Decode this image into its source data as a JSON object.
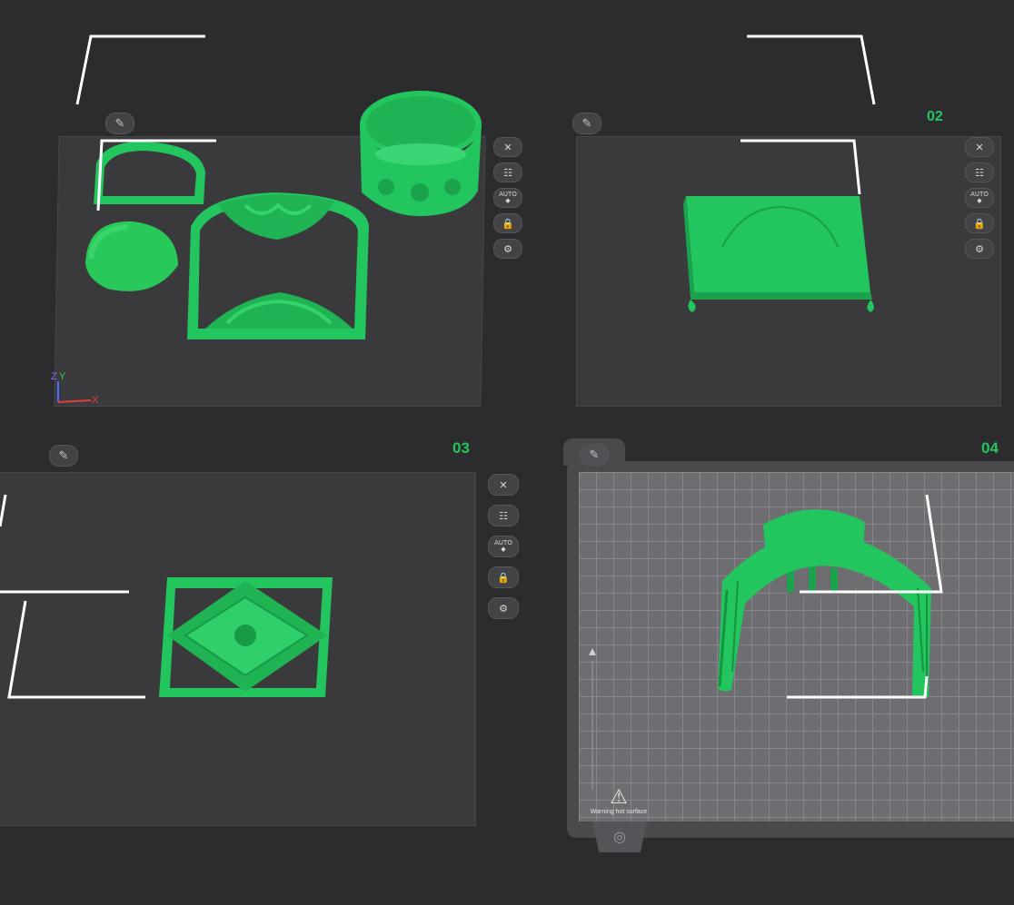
{
  "plates": [
    {
      "id": "plate-1",
      "number": ""
    },
    {
      "id": "plate-2",
      "number": "02"
    },
    {
      "id": "plate-3",
      "number": "03"
    },
    {
      "id": "plate-4",
      "number": "04"
    }
  ],
  "toolbar": {
    "close_icon": "✕",
    "list_icon": "☷",
    "auto_label": "AUTO",
    "lock_icon": "🔒",
    "settings_icon": "⚙",
    "edit_icon": "✎"
  },
  "axes": {
    "z": "Z",
    "y": "Y",
    "x": "X"
  },
  "plate4": {
    "warning": "Warning hot surface"
  },
  "colors": {
    "model": "#22c55e",
    "plate_number": "#22c55e",
    "plate": "#3a3a3c",
    "background": "#2c2c2e"
  }
}
